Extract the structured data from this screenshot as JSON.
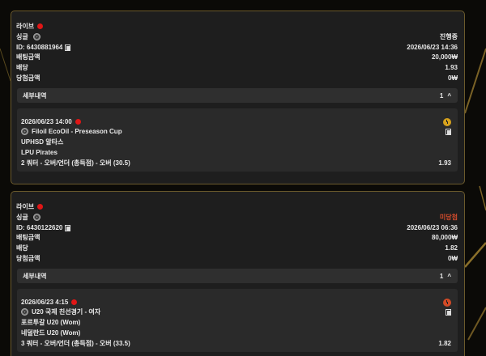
{
  "colors": {
    "accent_gold": "#d7a21c",
    "live_red": "#e01616",
    "pending_orange": "#d34b2c"
  },
  "bets": [
    {
      "type_label": "라이브",
      "kind_label": "싱글",
      "sport_icon": "soccer-ball-icon",
      "status": "진행중",
      "id_text": "ID: 6430881964",
      "datetime": "2026/06/23 14:36",
      "stake_label": "배팅금액",
      "stake_value": "20,000₩",
      "odds_label": "배당",
      "odds_value": "1.93",
      "win_label": "당첨금액",
      "win_value": "0₩",
      "details_label": "세부내역",
      "details_count": "1",
      "details_chevron": "^",
      "event": {
        "datetime": "2026/06/23 14:00",
        "league": "Filoil EcoOil - Preseason Cup",
        "team1": "UPHSD 알타스",
        "team2": "LPU Pirates",
        "market": "2 쿼터 - 오버/언더 (총득점) - 오버 (30.5)",
        "odds": "1.93",
        "status_icon": "clock-icon-gold"
      }
    },
    {
      "type_label": "라이브",
      "kind_label": "싱글",
      "sport_icon": "soccer-ball-icon",
      "status": "미당첨",
      "id_text": "ID: 6430122620",
      "datetime": "2026/06/23 06:36",
      "stake_label": "배팅금액",
      "stake_value": "80,000₩",
      "odds_label": "배당",
      "odds_value": "1.82",
      "win_label": "당첨금액",
      "win_value": "0₩",
      "details_label": "세부내역",
      "details_count": "1",
      "details_chevron": "^",
      "event": {
        "datetime": "2026/06/23 4:15",
        "league": "U20 국제 친선경기 - 여자",
        "team1": "포르투갈 U20 (Wom)",
        "team2": "네덜란드 U20 (Wom)",
        "market": "3 쿼터 - 오버/언더 (총득점) - 오버 (33.5)",
        "odds": "1.82",
        "status_icon": "clock-icon-red"
      }
    }
  ]
}
